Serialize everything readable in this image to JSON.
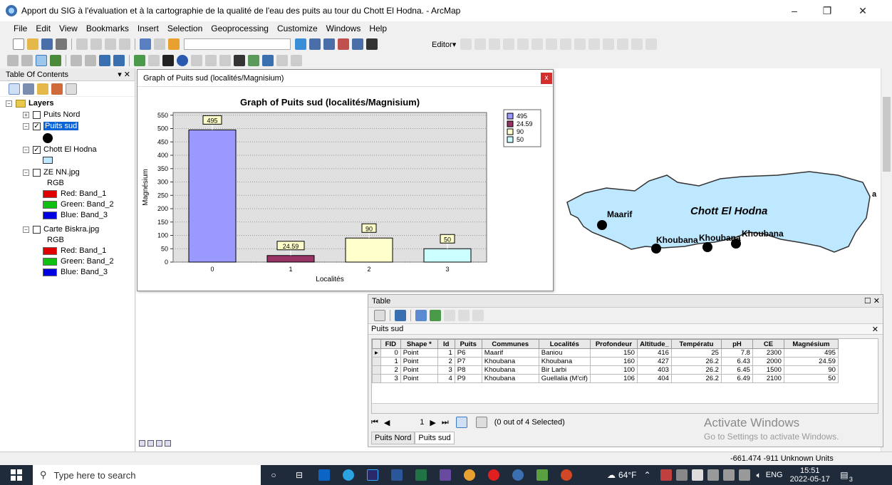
{
  "window": {
    "title": "Apport du SIG à l'évaluation et à la cartographie de la qualité de l'eau des puits au tour du Chott El Hodna. - ArcMap",
    "minimize": "–",
    "maximize": "❐",
    "close": "✕"
  },
  "menu": [
    "File",
    "Edit",
    "View",
    "Bookmarks",
    "Insert",
    "Selection",
    "Geoprocessing",
    "Customize",
    "Windows",
    "Help"
  ],
  "editor_label": "Editor▾",
  "toc": {
    "title": "Table Of Contents",
    "pin": "▾ ✕",
    "layers_label": "Layers",
    "puits_nord": "Puits Nord",
    "puits_sud": "Puits sud",
    "chott": "Chott El Hodna",
    "ze_nn": "ZE NN.jpg",
    "rgb1": "RGB",
    "red1": "Red:  Band_1",
    "green1": "Green: Band_2",
    "blue1": "Blue:  Band_3",
    "carte": "Carte Biskra.jpg",
    "rgb2": "RGB",
    "red2": "Red:  Band_1",
    "green2": "Green: Band_2",
    "blue2": "Blue:  Band_3"
  },
  "graph_window": {
    "title": "Graph of Puits sud (localités/Magnisium)",
    "close": "x"
  },
  "chart_data": {
    "type": "bar",
    "title": "Graph of Puits sud (localités/Magnisium)",
    "xlabel": "Localités",
    "ylabel": "Magnésium",
    "categories": [
      "0",
      "1",
      "2",
      "3"
    ],
    "values": [
      495,
      24.59,
      90,
      50
    ],
    "data_labels": [
      "495",
      "24.59",
      "90",
      "50"
    ],
    "colors": [
      "#9999ff",
      "#993366",
      "#ffffcc",
      "#ccffff"
    ],
    "ylim": [
      0,
      560
    ],
    "yticks": [
      0,
      50,
      100,
      150,
      200,
      250,
      300,
      350,
      400,
      450,
      500,
      550
    ],
    "legend": [
      "495",
      "24.59",
      "90",
      "50"
    ],
    "legend_position": "top-right",
    "grid": true
  },
  "map": {
    "chott_label": "Chott El Hodna",
    "maarif": "Maarif",
    "khoubana1": "Khoubana",
    "khoubana2": "Khoubana",
    "khoubana3": "Khoubana",
    "edge_label": "a"
  },
  "table": {
    "window_title": "Table",
    "window_controls": "☐ ✕",
    "tab_title": "Puits sud",
    "tab_close": "✕",
    "columns": [
      "FID",
      "Shape *",
      "Id",
      "Puits",
      "Communes",
      "Localités",
      "Profondeur",
      "Altitude_",
      "Températu",
      "pH",
      "CE",
      "Magnésium"
    ],
    "rows": [
      [
        "0",
        "Point",
        "1",
        "P6",
        "Maarif",
        "Baniou",
        "150",
        "416",
        "25",
        "7.8",
        "2300",
        "495"
      ],
      [
        "1",
        "Point",
        "2",
        "P7",
        "Khoubana",
        "Khoubana",
        "160",
        "427",
        "26.2",
        "6.43",
        "2000",
        "24.59"
      ],
      [
        "2",
        "Point",
        "3",
        "P8",
        "Khoubana",
        "Bir Larbi",
        "100",
        "403",
        "26.2",
        "6.45",
        "1500",
        "90"
      ],
      [
        "3",
        "Point",
        "4",
        "P9",
        "Khoubana",
        "Guellalia (M'cif)",
        "106",
        "404",
        "26.2",
        "6.49",
        "2100",
        "50"
      ]
    ],
    "record": "1",
    "selection_status": "(0 out of 4 Selected)",
    "tabs": [
      "Puits Nord",
      "Puits sud"
    ]
  },
  "watermark": {
    "line1": "Activate Windows",
    "line2": "Go to Settings to activate Windows."
  },
  "status": {
    "coords": "-661.474  -911 Unknown Units"
  },
  "taskbar": {
    "search_placeholder": "Type here to search",
    "weather": "64°F",
    "lang": "ENG",
    "time": "15:51",
    "date": "2022-05-17",
    "notif": "3"
  }
}
